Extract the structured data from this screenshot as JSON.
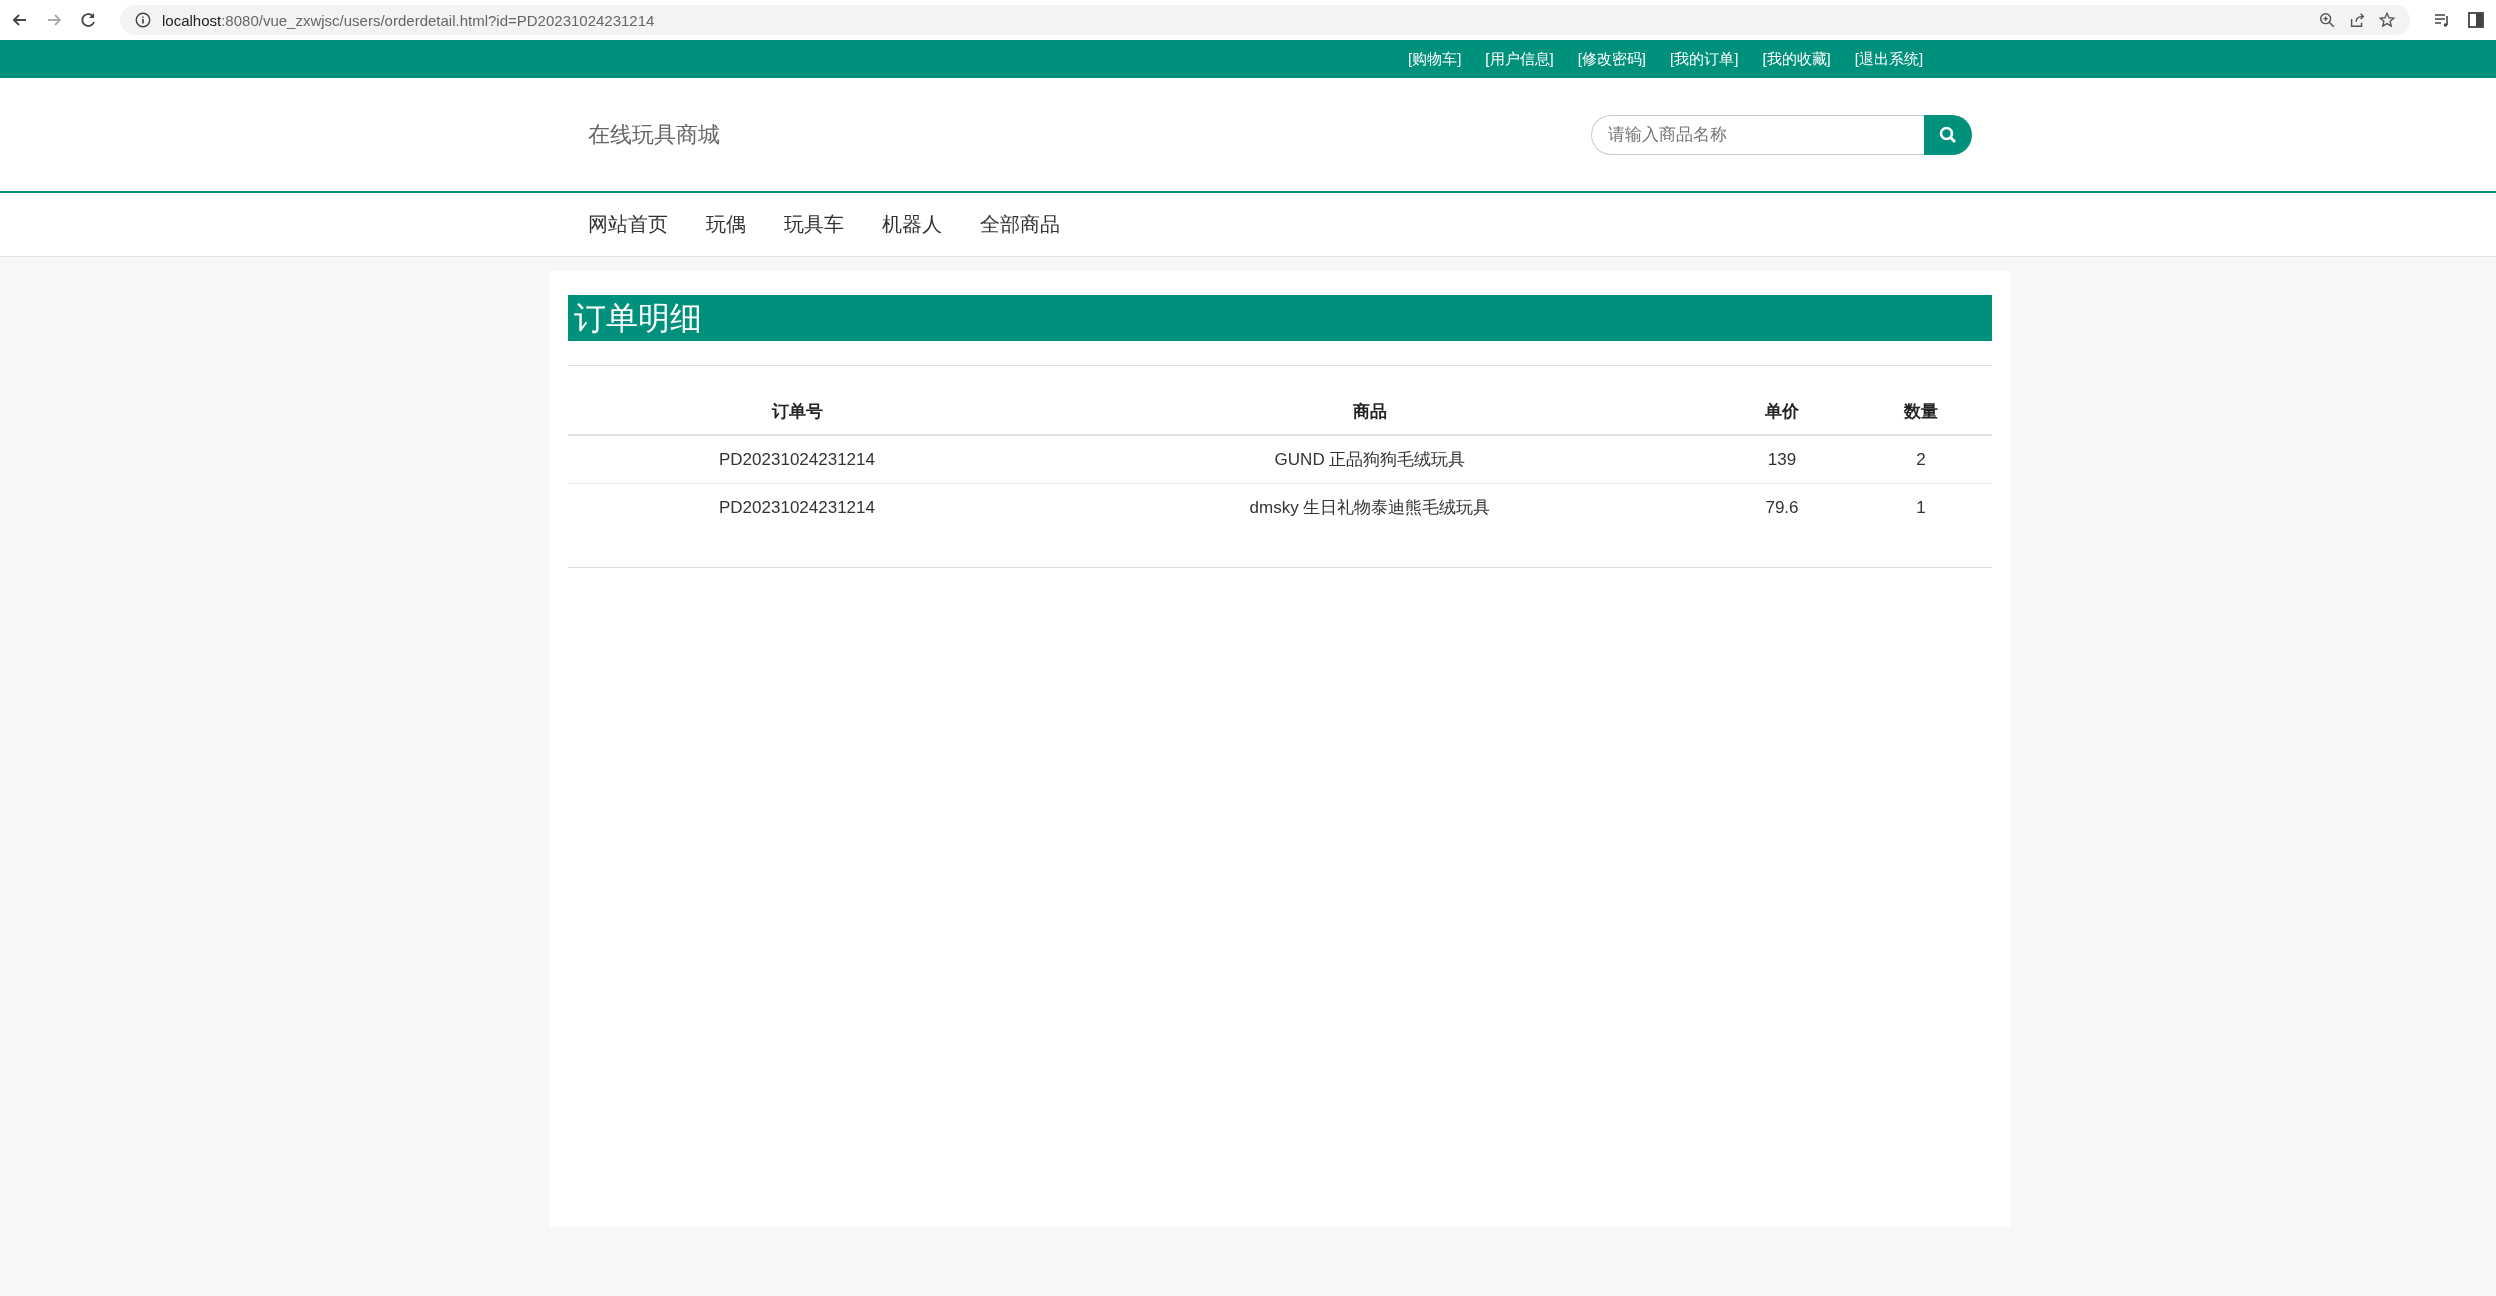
{
  "browser": {
    "url_host": "localhost",
    "url_rest": ":8080/vue_zxwjsc/users/orderdetail.html?id=PD20231024231214"
  },
  "top_links": [
    "[购物车]",
    "[用户信息]",
    "[修改密码]",
    "[我的订单]",
    "[我的收藏]",
    "[退出系统]"
  ],
  "logo": "在线玩具商城",
  "search": {
    "placeholder": "请输入商品名称"
  },
  "nav": [
    "网站首页",
    "玩偶",
    "玩具车",
    "机器人",
    "全部商品"
  ],
  "panel": {
    "title": "订单明细",
    "table": {
      "columns": [
        "订单号",
        "商品",
        "单价",
        "数量"
      ],
      "rows": [
        [
          "PD20231024231214",
          "GUND 正品狗狗毛绒玩具",
          "139",
          "2"
        ],
        [
          "PD20231024231214",
          "dmsky 生日礼物泰迪熊毛绒玩具",
          "79.6",
          "1"
        ]
      ]
    }
  }
}
